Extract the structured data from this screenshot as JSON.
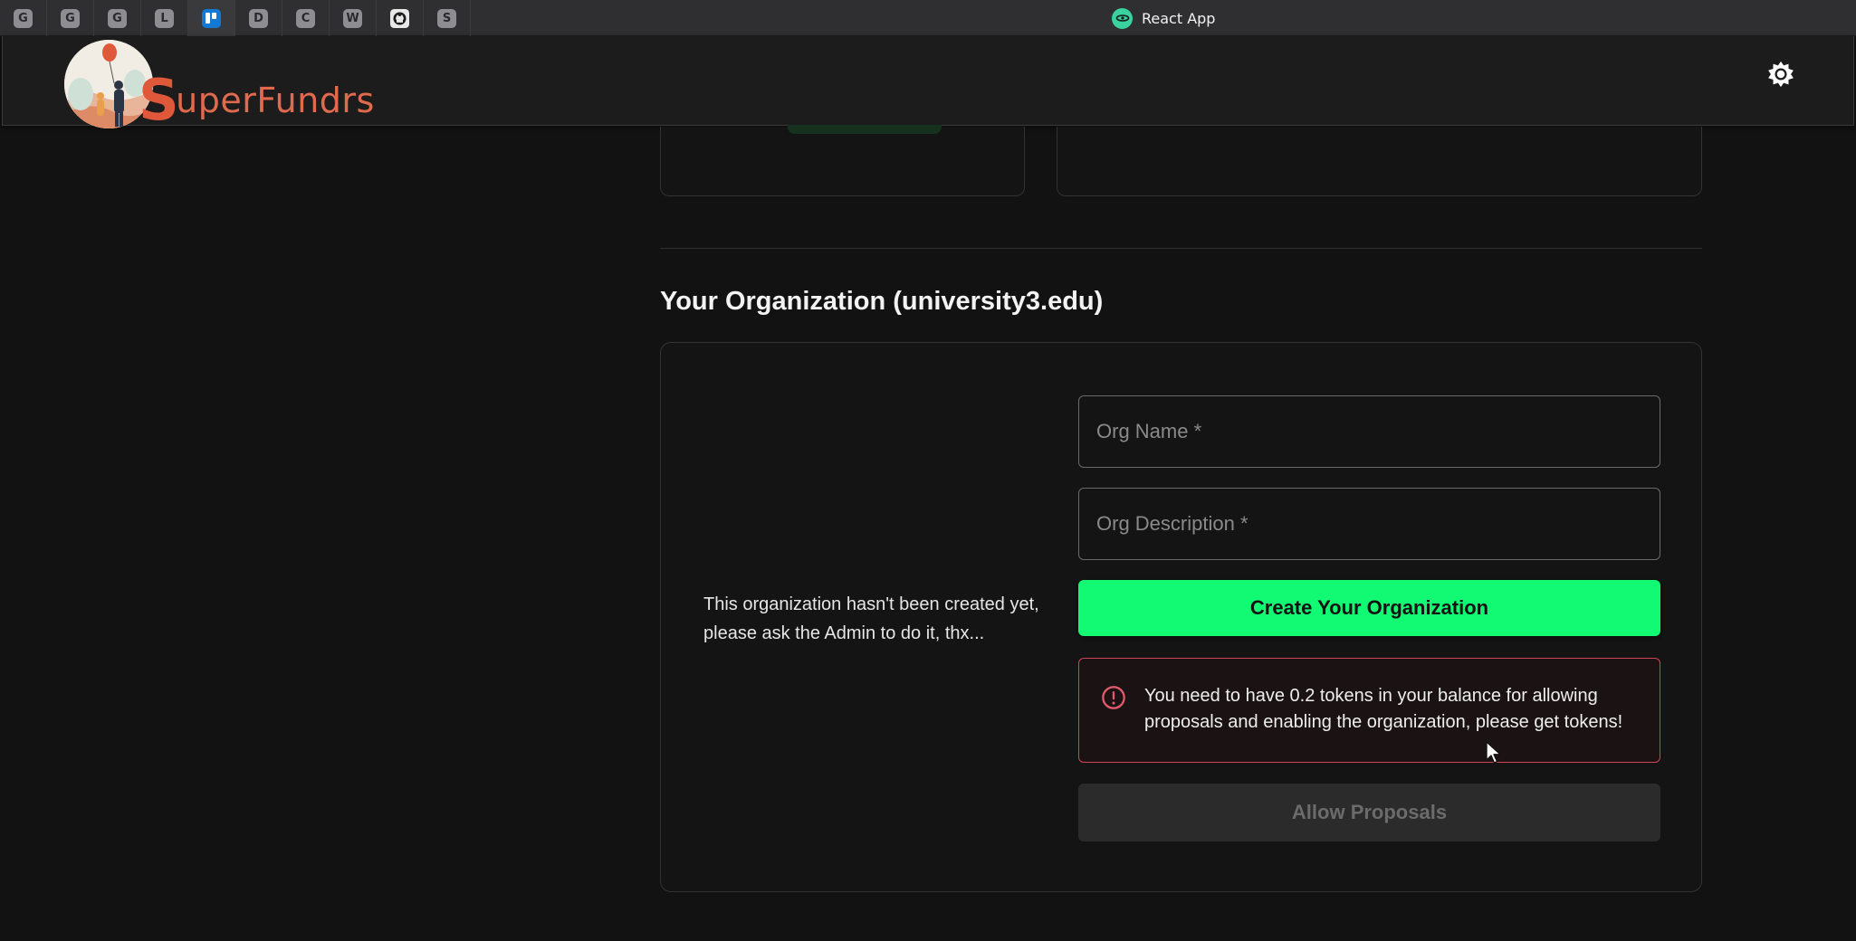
{
  "browser": {
    "tabs": [
      {
        "glyph": "G",
        "icon": "google-icon"
      },
      {
        "glyph": "G",
        "icon": "google-icon"
      },
      {
        "glyph": "G",
        "icon": "google-icon"
      },
      {
        "glyph": "L",
        "icon": "letter-l-icon"
      },
      {
        "glyph": "",
        "icon": "trello-icon"
      },
      {
        "glyph": "D",
        "icon": "letter-d-icon"
      },
      {
        "glyph": "C",
        "icon": "letter-c-icon"
      },
      {
        "glyph": "W",
        "icon": "letter-w-icon"
      },
      {
        "glyph": "",
        "icon": "github-icon"
      },
      {
        "glyph": "S",
        "icon": "letter-s-icon"
      }
    ],
    "active_tab_title": "React App"
  },
  "header": {
    "brand_initial": "S",
    "brand_rest": "uperFundrs",
    "theme_toggle_icon": "sun-icon"
  },
  "organization": {
    "title": "Your Organization (university3.edu)",
    "notice": "This organization hasn't been created yet, please ask the Admin to do it, thx...",
    "name_placeholder": "Org Name *",
    "description_placeholder": "Org Description *",
    "create_label": "Create Your Organization",
    "alert": "You need to have 0.2 tokens in your balance for allowing proposals and enabling the organization, please get tokens!",
    "allow_label": "Allow Proposals"
  },
  "colors": {
    "accent": "#12fa73",
    "error": "#d2435a",
    "brand": "#e06a4e"
  }
}
